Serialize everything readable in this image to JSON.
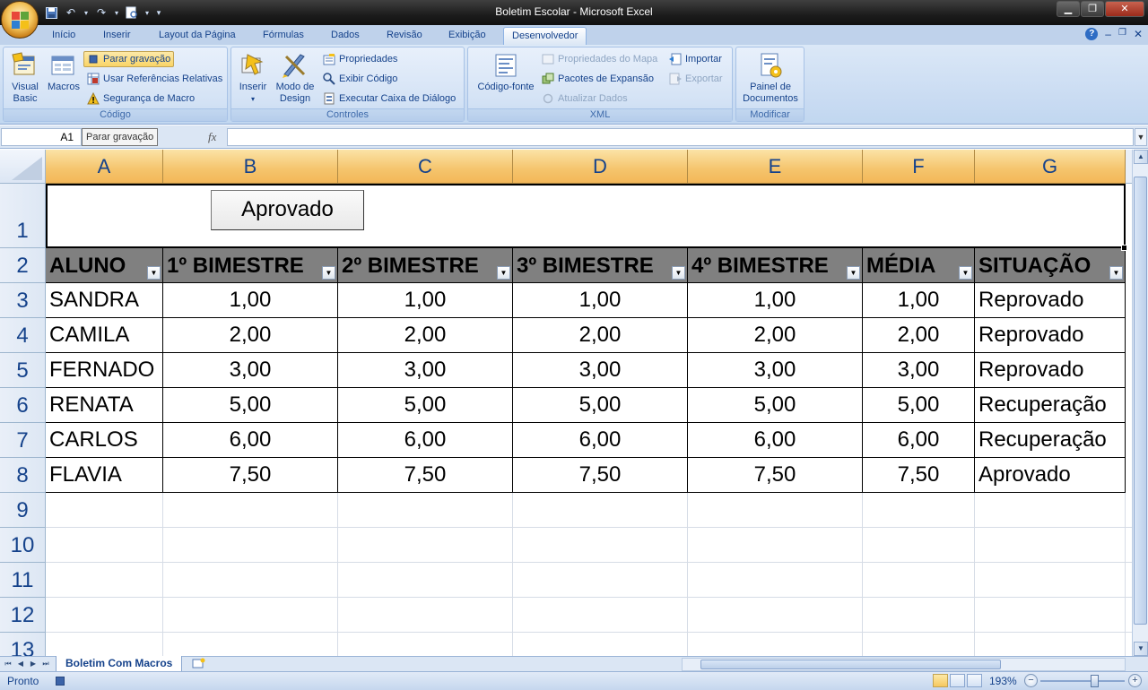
{
  "window": {
    "title": "Boletim Escolar - Microsoft Excel",
    "controls": [
      "minimize",
      "restore",
      "close"
    ]
  },
  "tabs": [
    {
      "label": "Início"
    },
    {
      "label": "Inserir"
    },
    {
      "label": "Layout da Página"
    },
    {
      "label": "Fórmulas"
    },
    {
      "label": "Dados"
    },
    {
      "label": "Revisão"
    },
    {
      "label": "Exibição"
    },
    {
      "label": "Desenvolvedor",
      "active": true
    }
  ],
  "ribbon": {
    "codigo": {
      "label": "Código",
      "visual_basic": "Visual Basic",
      "macros": "Macros",
      "parar_gravacao": "Parar gravação",
      "referencias_relativas": "Usar Referências Relativas",
      "seguranca_macro": "Segurança de Macro"
    },
    "controles": {
      "label": "Controles",
      "inserir": "Inserir",
      "modo_design": "Modo de Design",
      "propriedades": "Propriedades",
      "exibir_codigo": "Exibir Código",
      "executar_caixa": "Executar Caixa de Diálogo"
    },
    "xml": {
      "label": "XML",
      "codigo_fonte": "Código-fonte",
      "propriedades_mapa": "Propriedades do Mapa",
      "pacotes_expansao": "Pacotes de Expansão",
      "atualizar_dados": "Atualizar Dados",
      "importar": "Importar",
      "exportar": "Exportar"
    },
    "modificar": {
      "label": "Modificar",
      "painel_documentos": "Painel de Documentos"
    }
  },
  "formula_bar": {
    "name_box": "A1",
    "tooltip": "Parar gravação",
    "fx": "fx",
    "content": ""
  },
  "sheet": {
    "columns": [
      "A",
      "B",
      "C",
      "D",
      "E",
      "F",
      "G"
    ],
    "rows": [
      "1",
      "2",
      "3",
      "4",
      "5",
      "6",
      "7",
      "8",
      "9",
      "10",
      "11",
      "12",
      "13"
    ],
    "button_label": "Aprovado",
    "table_headers": [
      "ALUNO",
      "1º BIMESTRE",
      "2º BIMESTRE",
      "3º BIMESTRE",
      "4º BIMESTRE",
      "MÉDIA",
      "SITUAÇÃO"
    ],
    "table_rows": [
      [
        "SANDRA",
        "1,00",
        "1,00",
        "1,00",
        "1,00",
        "1,00",
        "Reprovado"
      ],
      [
        "CAMILA",
        "2,00",
        "2,00",
        "2,00",
        "2,00",
        "2,00",
        "Reprovado"
      ],
      [
        "FERNADO",
        "3,00",
        "3,00",
        "3,00",
        "3,00",
        "3,00",
        "Reprovado"
      ],
      [
        "RENATA",
        "5,00",
        "5,00",
        "5,00",
        "5,00",
        "5,00",
        "Recuperação"
      ],
      [
        "CARLOS",
        "6,00",
        "6,00",
        "6,00",
        "6,00",
        "6,00",
        "Recuperação"
      ],
      [
        "FLAVIA",
        "7,50",
        "7,50",
        "7,50",
        "7,50",
        "7,50",
        "Aprovado"
      ]
    ],
    "header_fill_color": "#808080",
    "column_header_color": "#f5c46c"
  },
  "sheet_tabs": {
    "active": "Boletim Com Macros"
  },
  "status": {
    "text": "Pronto",
    "zoom": "193%"
  }
}
